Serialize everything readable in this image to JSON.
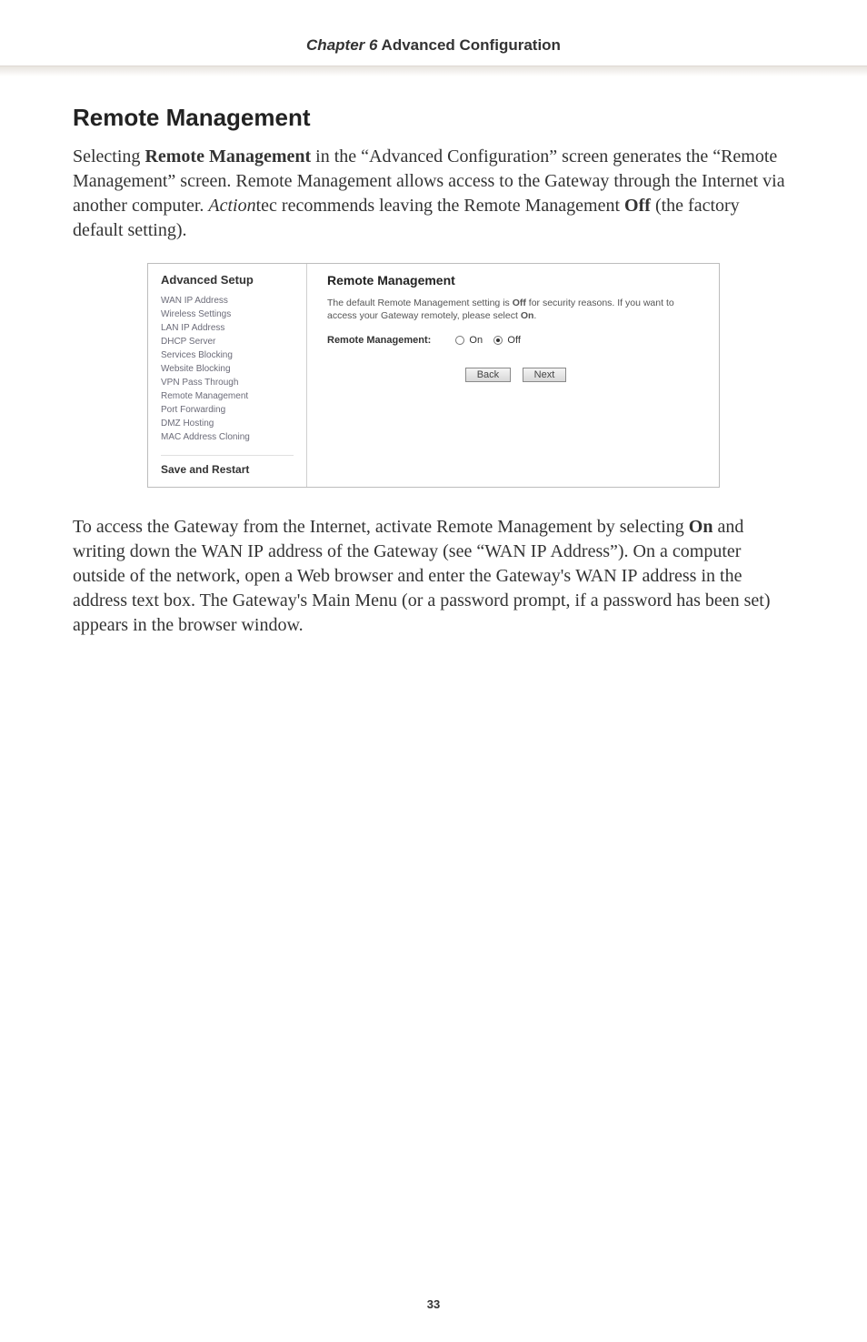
{
  "header": {
    "chapter_label": "Chapter 6",
    "chapter_title": " Advanced Configuration"
  },
  "section": {
    "title": "Remote Management"
  },
  "para1": {
    "t1": "Selecting ",
    "b1": "Remote Management",
    "t2": " in the “Advanced Configuration” screen generates the “Remote Management” screen. Remote Management allows access to the Gateway through the Internet via another computer. ",
    "i1": "Action",
    "t3": "tec recommends leaving the Remote Management ",
    "b2": "Off",
    "t4": " (the factory default setting)."
  },
  "screenshot": {
    "left_title": "Advanced Setup",
    "nav": {
      "i0": "WAN IP Address",
      "i1": "Wireless Settings",
      "i2": "LAN IP Address",
      "i3": "DHCP Server",
      "i4": "Services Blocking",
      "i5": "Website Blocking",
      "i6": "VPN Pass Through",
      "i7": "Remote Management",
      "i8": "Port Forwarding",
      "i9": "DMZ Hosting",
      "i10": "MAC Address Cloning"
    },
    "save_restart": "Save and Restart",
    "right_title": "Remote Management",
    "desc_p1": "The default Remote Management setting is ",
    "desc_b1": "Off",
    "desc_p2": " for security reasons. If you want to access your Gateway remotely, please select ",
    "desc_b2": "On",
    "desc_p3": ".",
    "field_label": "Remote Management:",
    "radio_on": "On",
    "radio_off": "Off",
    "btn_back": "Back",
    "btn_next": "Next"
  },
  "para2": {
    "t1": "To access the Gateway from the Internet, activate Remote Management by selecting ",
    "b1": "On",
    "t2": " and writing down the ",
    "sc1": "WAN IP",
    "t3": " address of the Gateway (see “",
    "sc2": "WAN IP",
    "t4": " Address”). On a computer outside of the network, open a Web browser and enter the Gateway's ",
    "sc3": "WAN IP",
    "t5": " address in the address text box. The Gateway's Main Menu (or a password prompt, if a password has been set) appears in the browser window."
  },
  "page_number": "33"
}
